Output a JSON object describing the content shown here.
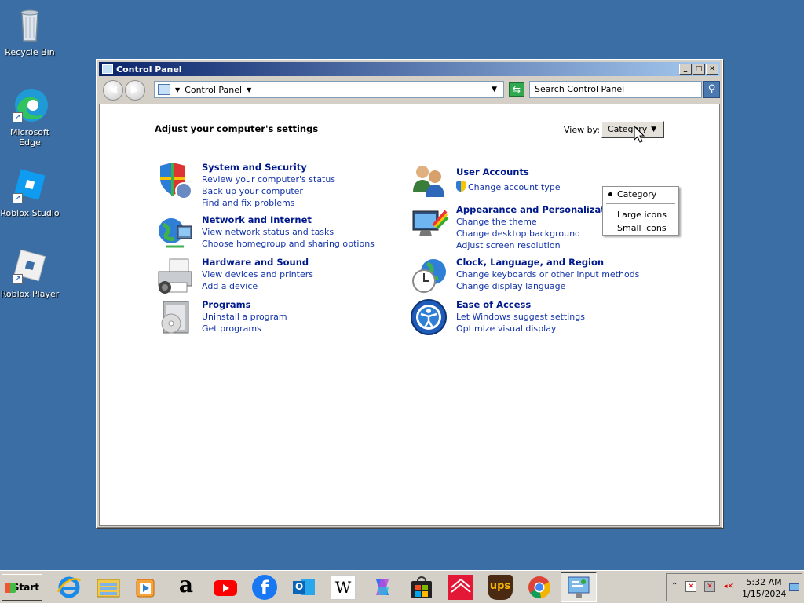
{
  "desktop": {
    "icons": [
      {
        "label": "Recycle Bin",
        "icon": "recycle-bin-icon"
      },
      {
        "label": "Microsoft Edge",
        "icon": "edge-icon"
      },
      {
        "label": "Roblox Studio",
        "icon": "roblox-studio-icon"
      },
      {
        "label": "Roblox Player",
        "icon": "roblox-player-icon"
      }
    ]
  },
  "window": {
    "title": "Control Panel",
    "address": {
      "label": "Control Panel"
    },
    "search": {
      "placeholder": "Search Control Panel"
    },
    "heading": "Adjust your computer's settings",
    "view_by": {
      "label": "View by:",
      "value": "Category"
    },
    "view_menu": {
      "options": [
        "Category",
        "Large icons",
        "Small icons"
      ],
      "selected": "Category"
    },
    "categories": [
      {
        "title": "System and Security",
        "icon": "shield-icon",
        "links": [
          "Review your computer's status",
          "Back up your computer",
          "Find and fix problems"
        ]
      },
      {
        "title": "Network and Internet",
        "icon": "network-globe-icon",
        "links": [
          "View network status and tasks",
          "Choose homegroup and sharing options"
        ]
      },
      {
        "title": "Hardware and Sound",
        "icon": "printer-icon",
        "links": [
          "View devices and printers",
          "Add a device"
        ]
      },
      {
        "title": "Programs",
        "icon": "programs-disc-icon",
        "links": [
          "Uninstall a program",
          "Get programs"
        ]
      },
      {
        "title": "User Accounts",
        "icon": "users-icon",
        "links": [
          "Change account type"
        ]
      },
      {
        "title": "Appearance and Personalization",
        "icon": "monitor-paint-icon",
        "links": [
          "Change the theme",
          "Change desktop background",
          "Adjust screen resolution"
        ]
      },
      {
        "title": "Clock, Language, and Region",
        "icon": "clock-globe-icon",
        "links": [
          "Change keyboards or other input methods",
          "Change display language"
        ]
      },
      {
        "title": "Ease of Access",
        "icon": "ease-of-access-icon",
        "links": [
          "Let Windows suggest settings",
          "Optimize visual display"
        ]
      }
    ]
  },
  "taskbar": {
    "start_label": "Start",
    "apps": [
      "internet-explorer-icon",
      "file-explorer-icon",
      "media-player-icon",
      "amazon-icon",
      "youtube-icon",
      "facebook-icon",
      "outlook-icon",
      "wikipedia-icon",
      "copilot-icon",
      "microsoft-store-icon",
      "bank-of-america-icon",
      "ups-icon",
      "chrome-icon",
      "control-panel-icon"
    ],
    "amazon_glyph": "a",
    "wikipedia_glyph": "W",
    "ups_glyph": "ups",
    "outlook_glyph": "O",
    "facebook_glyph": "f",
    "clock": {
      "time": "5:32 AM",
      "date": "1/15/2024"
    }
  },
  "colors": {
    "desktop": "#3a6ea5",
    "link": "#1233a8",
    "heading_link": "#001a8c"
  }
}
